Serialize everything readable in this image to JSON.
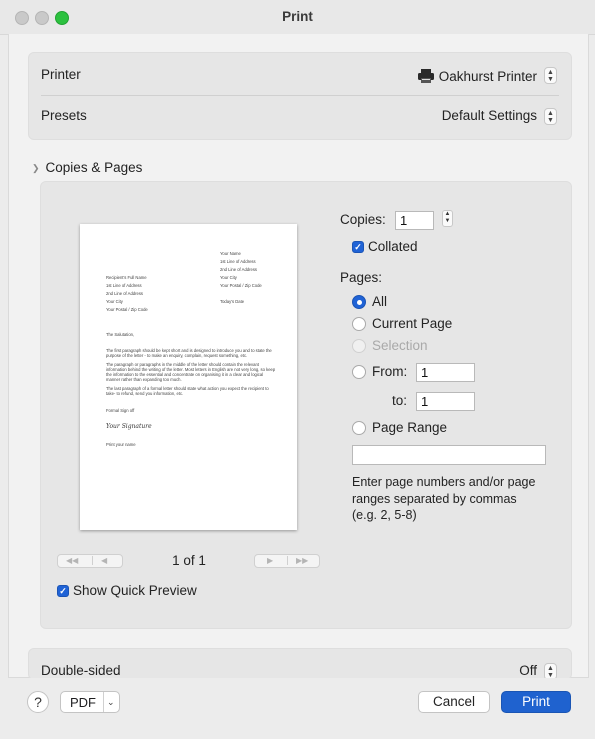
{
  "window": {
    "title": "Print"
  },
  "printer": {
    "label": "Printer",
    "value": "Oakhurst Printer",
    "icon": "printer-icon"
  },
  "presets": {
    "label": "Presets",
    "value": "Default Settings"
  },
  "section": {
    "title": "Copies & Pages"
  },
  "preview": {
    "page_count": "1 of 1",
    "show_quick_preview": "Show Quick Preview",
    "letter": {
      "your_name": "Your Name",
      "line1": "1st Line of Address",
      "line2": "2nd Line of Address",
      "your_city": "Your City",
      "postal": "Your Postal / Zip Code",
      "today": "Today's Date",
      "recipient": "Recipient's Full Name",
      "r_line1": "1st Line of Address",
      "r_line2": "2nd Line of Address",
      "r_city": "Your City",
      "r_postal": "Your Postal / Zip Code",
      "salutation": "The Salutation,",
      "p1a": "The first paragraph should be kept short and is designed to introduce you and to state the",
      "p1b": "purpose of the letter - to make an enquiry, complain, request something, etc.",
      "p2a": "The paragraph or paragraphs in the middle of the letter should contain the relevant",
      "p2b": "information behind the writing of the letter. Most letters in English are not very long, so keep",
      "p2c": "the information to the essential and concentrate on organising it in a clear and logical",
      "p2d": "manner rather than expanding too much.",
      "p3a": "The last paragraph of a formal letter should state what action you expect the recipient to",
      "p3b": "take- to refund, send you information, etc.",
      "signoff": "Formal Sign off",
      "signature": "Your Signature",
      "printname": "Print your name"
    }
  },
  "copies": {
    "label": "Copies:",
    "value": "1",
    "collated": "Collated"
  },
  "pages": {
    "label": "Pages:",
    "all": "All",
    "current": "Current Page",
    "selection": "Selection",
    "from": "From:",
    "from_value": "1",
    "to": "to:",
    "to_value": "1",
    "range": "Page Range",
    "range_value": "",
    "hint": "Enter page numbers and/or page ranges separated by commas (e.g. 2, 5-8)"
  },
  "double_sided": {
    "label": "Double-sided",
    "value": "Off"
  },
  "footer": {
    "help": "?",
    "pdf": "PDF",
    "cancel": "Cancel",
    "print": "Print"
  },
  "colors": {
    "accent": "#1f62cf"
  }
}
